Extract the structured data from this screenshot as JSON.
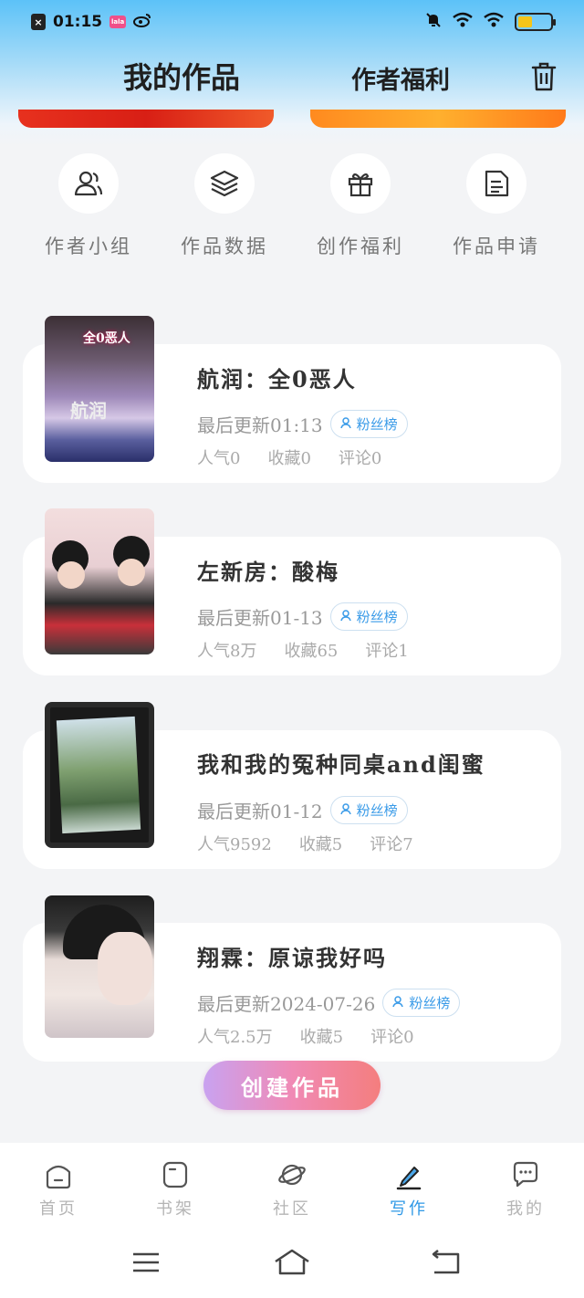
{
  "status_bar": {
    "time": "01:15",
    "app_badge": "lala",
    "weibo_icon": "weibo-icon",
    "battery_level": 0.45
  },
  "header": {
    "tab_works": "我的作品",
    "tab_benefits": "作者福利"
  },
  "quick_actions": [
    {
      "label": "作者小组",
      "icon": "group-icon"
    },
    {
      "label": "作品数据",
      "icon": "layers-icon"
    },
    {
      "label": "创作福利",
      "icon": "gift-icon"
    },
    {
      "label": "作品申请",
      "icon": "document-icon"
    }
  ],
  "works": [
    {
      "title": "航润：全0恶人",
      "last_update": "最后更新01:13",
      "fan_badge": "粉丝榜",
      "popularity": "人气0",
      "favorites": "收藏0",
      "comments": "评论0",
      "cover_text_top": "全0恶人",
      "cover_text_mid": "航润"
    },
    {
      "title": "左新房：酸梅",
      "last_update": "最后更新01-13",
      "fan_badge": "粉丝榜",
      "popularity": "人气8万",
      "favorites": "收藏65",
      "comments": "评论1"
    },
    {
      "title": "我和我的冤种同桌and闺蜜",
      "last_update": "最后更新01-12",
      "fan_badge": "粉丝榜",
      "popularity": "人气9592",
      "favorites": "收藏5",
      "comments": "评论7"
    },
    {
      "title": "翔霖：原谅我好吗",
      "last_update": "最后更新2024-07-26",
      "fan_badge": "粉丝榜",
      "popularity": "人气2.5万",
      "favorites": "收藏5",
      "comments": "评论0"
    }
  ],
  "create_button": "创建作品",
  "bottom_nav": [
    {
      "label": "首页",
      "icon": "home-icon",
      "active": false
    },
    {
      "label": "书架",
      "icon": "bookshelf-icon",
      "active": false
    },
    {
      "label": "社区",
      "icon": "planet-icon",
      "active": false
    },
    {
      "label": "写作",
      "icon": "pen-icon",
      "active": true
    },
    {
      "label": "我的",
      "icon": "chat-icon",
      "active": false
    }
  ],
  "colors": {
    "accent": "#2e98e6",
    "header_gradient_top": "#5cc2f8"
  }
}
